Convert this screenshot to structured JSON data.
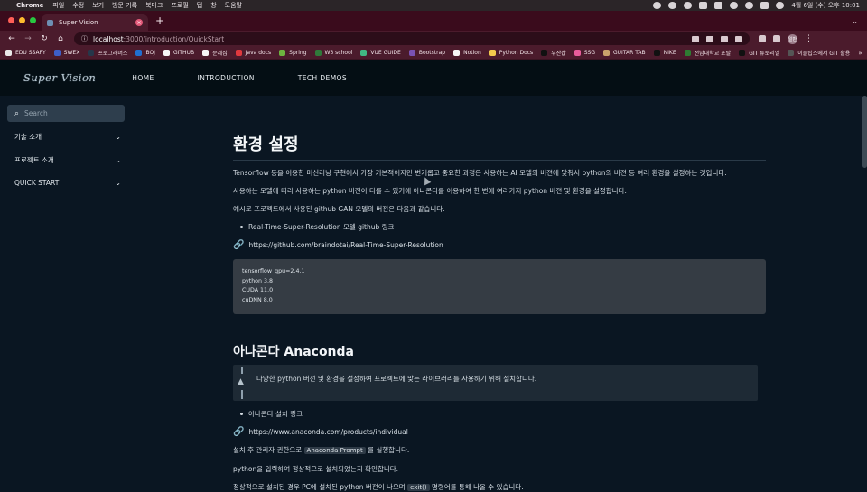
{
  "menubar": {
    "app_name": "Chrome",
    "items": [
      "파일",
      "수정",
      "보기",
      "방문 기록",
      "북마크",
      "프로필",
      "탭",
      "창",
      "도움말"
    ],
    "clock": "4월 6일 (수) 오후 10:01"
  },
  "browser": {
    "tab_title": "Super Vision",
    "new_tab_symbol": "+",
    "url_host": "localhost",
    "url_path": ":3000/introduction/QuickStart",
    "profile_badge": "일반"
  },
  "bookmarks": [
    {
      "label": "EDU SSAFY",
      "color": "#e9e9e9"
    },
    {
      "label": "SWEX",
      "color": "#3d5ec9"
    },
    {
      "label": "프로그래머스",
      "color": "#26374a"
    },
    {
      "label": "BOJ",
      "color": "#1f6fd1"
    },
    {
      "label": "GITHUB",
      "color": "#f5f5f5"
    },
    {
      "label": "문제집",
      "color": "#f5f5f5"
    },
    {
      "label": "Java docs",
      "color": "#e0393e"
    },
    {
      "label": "Spring",
      "color": "#6db33f"
    },
    {
      "label": "W3 school",
      "color": "#2f7a3a"
    },
    {
      "label": "VUE GUIDE",
      "color": "#41b883"
    },
    {
      "label": "Bootstrap",
      "color": "#7952b3"
    },
    {
      "label": "Notion",
      "color": "#f5f5f5"
    },
    {
      "label": "Python Docs",
      "color": "#f2c94c"
    },
    {
      "label": "우산샵",
      "color": "#111111"
    },
    {
      "label": "SSG",
      "color": "#e85c9a"
    },
    {
      "label": "GUITAR TAB",
      "color": "#c9a26b"
    },
    {
      "label": "NIKE",
      "color": "#111111"
    },
    {
      "label": "전남대학교 포탈",
      "color": "#2e7d32"
    },
    {
      "label": "GIT 튜토리얼",
      "color": "#111111"
    },
    {
      "label": "이클립스에서 GIT 활용",
      "color": "#555555"
    }
  ],
  "bookmarks_more": "»",
  "header": {
    "logo": "Super Vision",
    "nav": [
      "HOME",
      "INTRODUCTION",
      "TECH DEMOS"
    ]
  },
  "sidebar": {
    "search_placeholder": "Search",
    "items": [
      "기술 소개",
      "프로젝트 소개",
      "QUICK START"
    ]
  },
  "content": {
    "title": "환경 설정",
    "para1": "Tensorflow 등을 이용한 머신러닝 구현에서 가장 기본적이지만 번거롭고 중요한 과정은 사용하는 AI 모델의 버전에 맞춰서 python의 버전 등 여러 환경을 설정하는 것입니다.",
    "para2": "사용하는 모델에 따라 사용하는 python 버전이 다를 수 있기에 아나콘다를 이용하여 한 번에 여러가지 python 버전 및 환경을 설정합니다.",
    "para3": "예시로 프로젝트에서 사용된 github GAN 모델의 버전은 다음과 같습니다.",
    "bullet1": "Real-Time-Super-Resolution 모델 github 링크",
    "link1": "https://github.com/braindotai/Real-Time-Super-Resolution",
    "code_lines": [
      "tensorflow_gpu=2.4.1",
      "python 3.8",
      "CUDA 11.0",
      "cuDNN 8.0"
    ],
    "section2_title": "아나콘다 Anaconda",
    "callout": "다양한 python 버전 및 환경을 설정하여 프로젝트에 맞는 라이브러리를 사용하기 위해 설치합니다.",
    "bullet2": "아나콘다 설치 링크",
    "link2": "https://www.anaconda.com/products/individual",
    "para4_before": "설치 후 관리자 권한으로",
    "para4_code": "Anaconda Prompt",
    "para4_after": "를 실행합니다.",
    "para5": "python을 입력하여 정상적으로 설치되었는지 확인합니다.",
    "para6_before": "정상적으로 설치된 경우 PC에 설치된 python 버전이 나오며",
    "para6_code": "exit()",
    "para6_after": "명령어를 통해 나올 수 있습니다."
  }
}
